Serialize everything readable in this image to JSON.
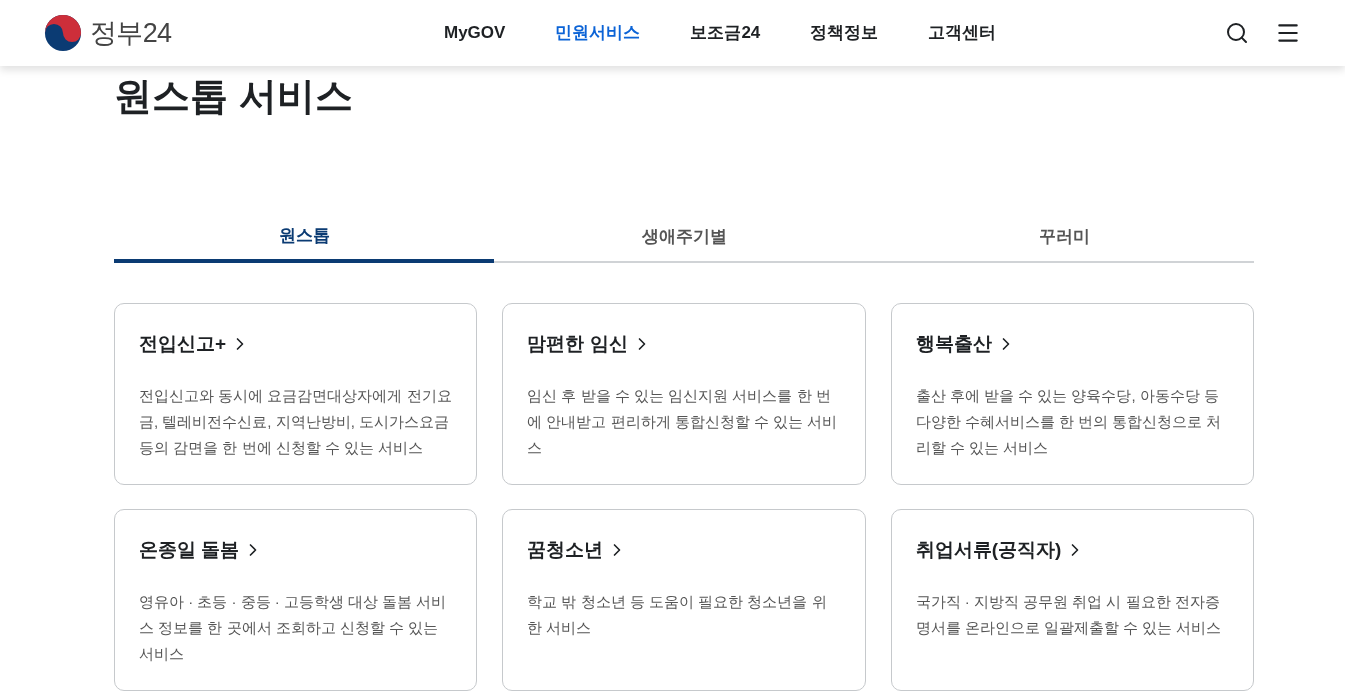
{
  "header": {
    "logo_text": "정부24",
    "nav": [
      {
        "label": "MyGOV",
        "selected": false
      },
      {
        "label": "민원서비스",
        "selected": true
      },
      {
        "label": "보조금24",
        "selected": false
      },
      {
        "label": "정책정보",
        "selected": false
      },
      {
        "label": "고객센터",
        "selected": false
      }
    ]
  },
  "page_title": "원스톱 서비스",
  "tabs": [
    {
      "label": "원스톱",
      "selected": true
    },
    {
      "label": "생애주기별",
      "selected": false
    },
    {
      "label": "꾸러미",
      "selected": false
    }
  ],
  "cards": [
    {
      "title": "전입신고+",
      "description": "전입신고와 동시에 요금감면대상자에게 전기요금, 텔레비전수신료, 지역난방비, 도시가스요금 등의 감면을 한 번에 신청할 수 있는 서비스"
    },
    {
      "title": "맘편한 임신",
      "description": "임신 후 받을 수 있는 임신지원 서비스를 한 번에 안내받고 편리하게 통합신청할 수 있는 서비스"
    },
    {
      "title": "행복출산",
      "description": "출산 후에 받을 수 있는 양육수당, 아동수당 등 다양한 수혜서비스를 한 번의 통합신청으로 처리할 수 있는 서비스"
    },
    {
      "title": "온종일 돌봄",
      "description": "영유아 · 초등 · 중등 · 고등학생 대상 돌봄 서비스 정보를 한 곳에서 조회하고 신청할 수 있는 서비스"
    },
    {
      "title": "꿈청소년",
      "description": "학교 밖 청소년 등 도움이 필요한 청소년을 위한 서비스"
    },
    {
      "title": "취업서류(공직자)",
      "description": "국가직 · 지방직 공무원 취업 시 필요한 전자증명서를 온라인으로 일괄제출할 수 있는 서비스"
    }
  ]
}
